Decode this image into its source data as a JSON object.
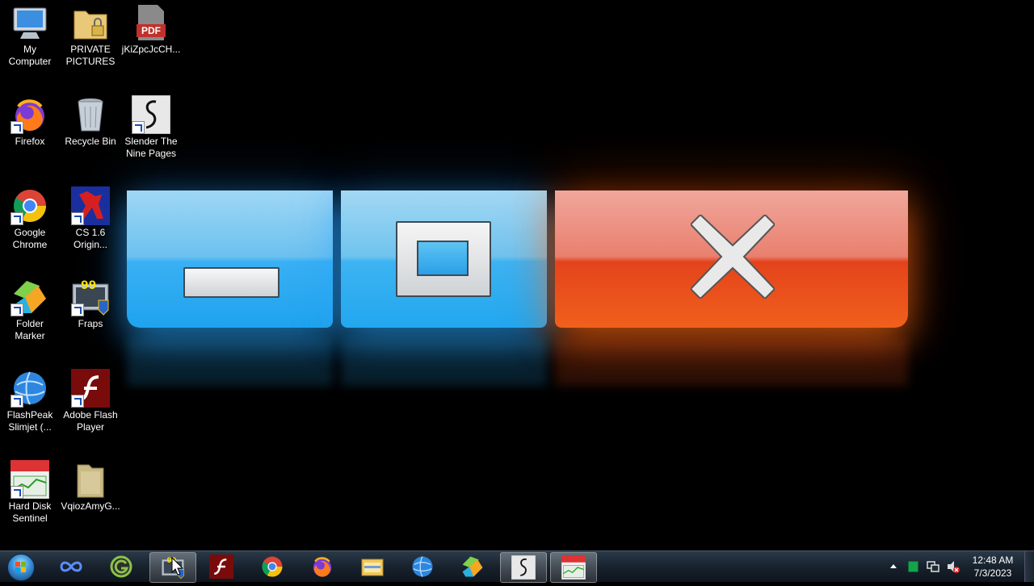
{
  "desktop_icons": [
    {
      "label_lines": [
        "My",
        "Computer"
      ],
      "icon": "computer-icon",
      "shortcut": false
    },
    {
      "label_lines": [
        "PRIVATE",
        "PICTURES"
      ],
      "icon": "locked-folder-icon",
      "shortcut": false
    },
    {
      "label_lines": [
        "jKiZpcJcCH..."
      ],
      "icon": "pdf-file-icon",
      "shortcut": false
    },
    {
      "label_lines": [
        "Firefox"
      ],
      "icon": "firefox-icon",
      "shortcut": true
    },
    {
      "label_lines": [
        "Recycle Bin"
      ],
      "icon": "recycle-bin-icon",
      "shortcut": false
    },
    {
      "label_lines": [
        "Slender The",
        "Nine Pages"
      ],
      "icon": "slender-icon",
      "shortcut": true
    },
    {
      "label_lines": [
        "Google",
        "Chrome"
      ],
      "icon": "chrome-icon",
      "shortcut": true
    },
    {
      "label_lines": [
        "CS 1.6",
        "Origin..."
      ],
      "icon": "counter-strike-icon",
      "shortcut": true
    },
    {
      "label_lines": [
        "Folder",
        "Marker"
      ],
      "icon": "folder-marker-icon",
      "shortcut": true
    },
    {
      "label_lines": [
        "Fraps"
      ],
      "icon": "fraps-icon",
      "shortcut": true
    },
    {
      "label_lines": [
        "FlashPeak",
        "Slimjet (..."
      ],
      "icon": "slimjet-icon",
      "shortcut": true
    },
    {
      "label_lines": [
        "Adobe Flash",
        "Player"
      ],
      "icon": "flash-player-icon",
      "shortcut": true
    },
    {
      "label_lines": [
        "Hard Disk",
        "Sentinel"
      ],
      "icon": "hard-disk-sentinel-icon",
      "shortcut": true
    },
    {
      "label_lines": [
        "VqiozAmyG..."
      ],
      "icon": "folder-icon",
      "shortcut": false
    }
  ],
  "pdf_badge": "PDF",
  "fraps_badge": "99",
  "taskbar": {
    "start_icon": "windows-start-orb-icon",
    "items": [
      {
        "icon": "infinity-app-icon",
        "active": false
      },
      {
        "icon": "g-app-icon",
        "active": false
      },
      {
        "icon": "fraps-icon",
        "active": true
      },
      {
        "icon": "flash-player-icon",
        "active": false
      },
      {
        "icon": "chrome-icon",
        "active": false
      },
      {
        "icon": "firefox-icon",
        "active": false
      },
      {
        "icon": "file-explorer-icon",
        "active": false
      },
      {
        "icon": "slimjet-icon",
        "active": false
      },
      {
        "icon": "folder-marker-icon",
        "active": false
      },
      {
        "icon": "slender-icon",
        "active": true
      },
      {
        "icon": "hard-disk-sentinel-icon",
        "active": true
      }
    ],
    "tray_icons": [
      "show-hidden-icons-icon",
      "green-status-icon",
      "network-icon",
      "volume-muted-icon"
    ],
    "clock": {
      "time": "12:48 AM",
      "date": "7/3/2023"
    }
  },
  "colors": {
    "taskbar": "#18222d",
    "wallpaper_blue": "#2aa8f0",
    "wallpaper_red": "#e8501c"
  }
}
